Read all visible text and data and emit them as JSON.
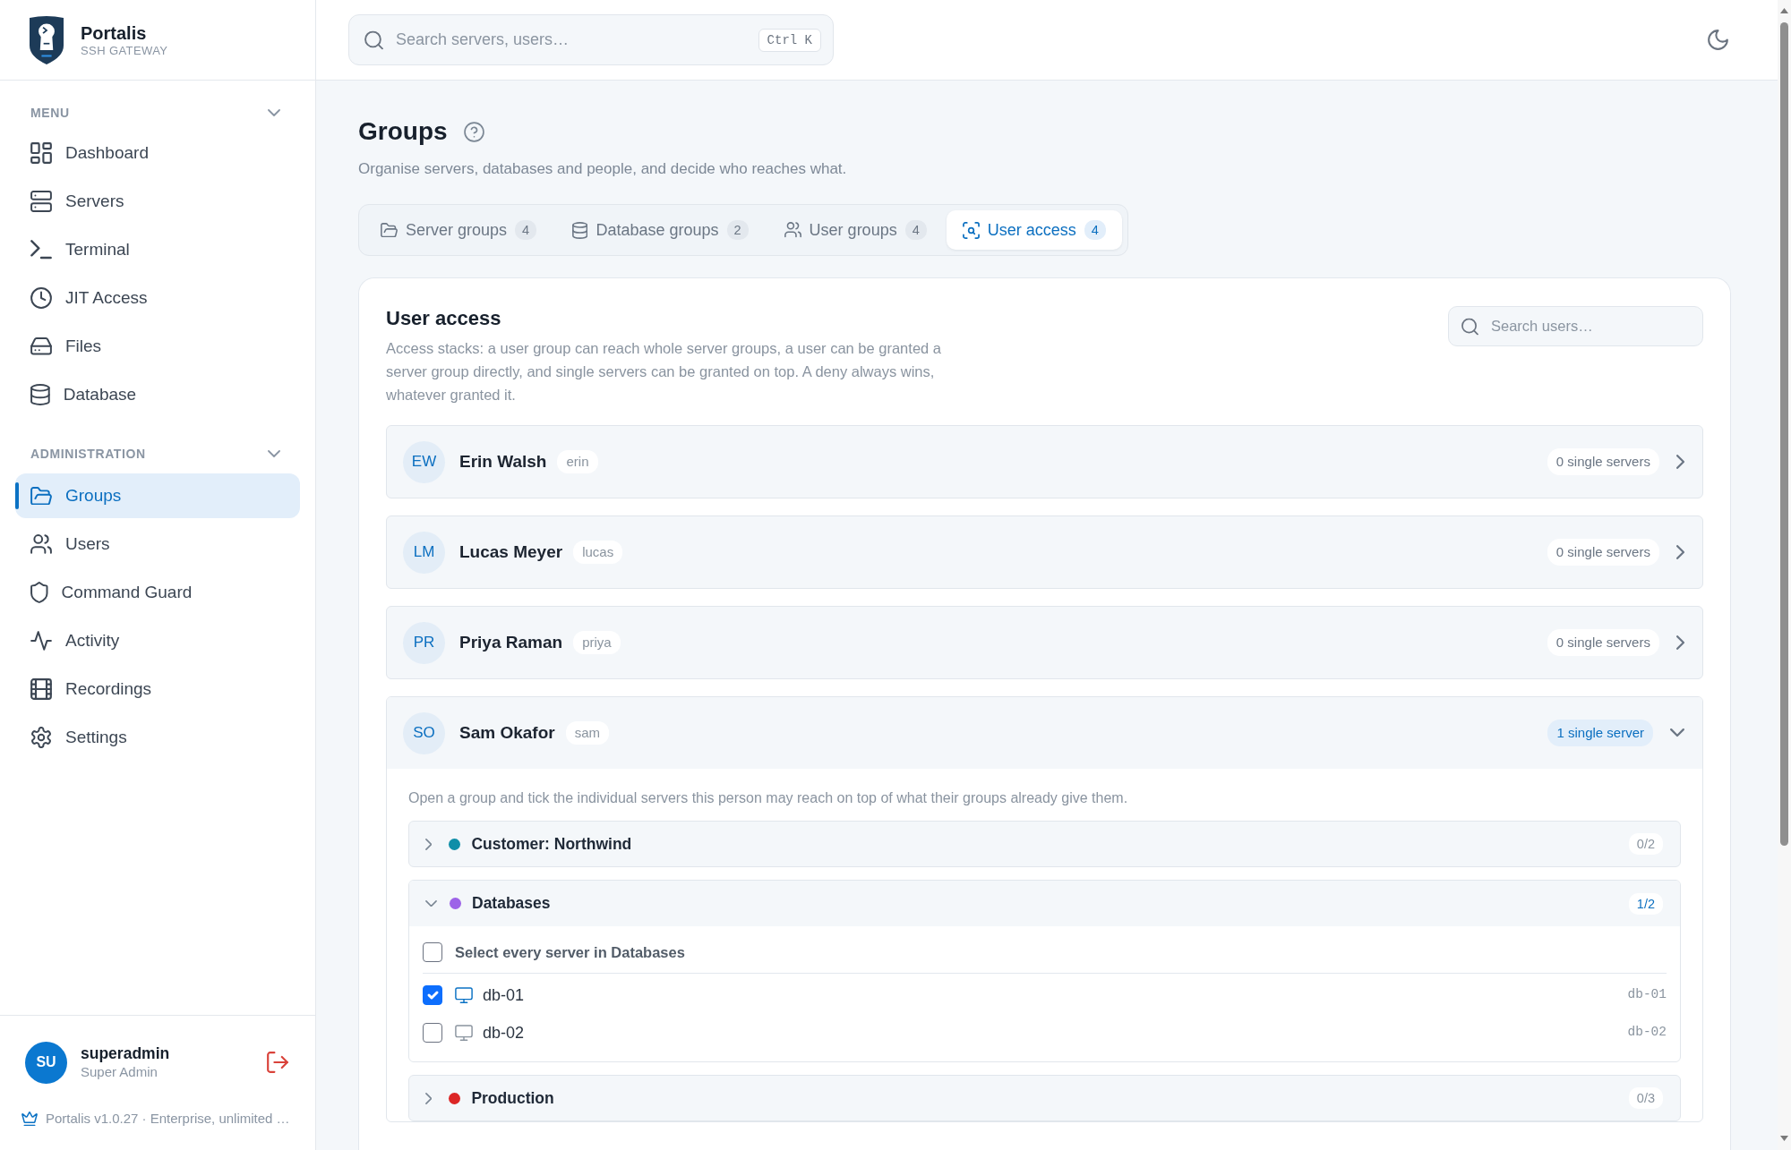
{
  "app": {
    "name": "Portalis",
    "tagline": "SSH GATEWAY"
  },
  "sidebar": {
    "sections": [
      {
        "label": "MENU",
        "expanded": true,
        "items": [
          {
            "label": "Dashboard",
            "selected": false
          },
          {
            "label": "Servers",
            "selected": false
          },
          {
            "label": "Terminal",
            "selected": false
          },
          {
            "label": "JIT Access",
            "selected": false
          },
          {
            "label": "Files",
            "selected": false
          },
          {
            "label": "Database",
            "selected": false
          }
        ]
      },
      {
        "label": "ADMINISTRATION",
        "expanded": true,
        "items": [
          {
            "label": "Groups",
            "selected": true
          },
          {
            "label": "Users",
            "selected": false
          },
          {
            "label": "Command Guard",
            "selected": false
          },
          {
            "label": "Activity",
            "selected": false
          },
          {
            "label": "Recordings",
            "selected": false
          },
          {
            "label": "Settings",
            "selected": false
          }
        ]
      }
    ],
    "user": {
      "initials": "SU",
      "name": "superadmin",
      "role": "Super Admin"
    },
    "footer": "Portalis v1.0.27 · Enterprise, unlimited …"
  },
  "topbar": {
    "search": {
      "placeholder": "Search servers, users…",
      "shortcut": "Ctrl K"
    }
  },
  "page": {
    "title": "Groups",
    "subtitle": "Organise servers, databases and people, and decide who reaches what."
  },
  "tabs": [
    {
      "label": "Server groups",
      "count": "4",
      "selected": false
    },
    {
      "label": "Database groups",
      "count": "2",
      "selected": false
    },
    {
      "label": "User groups",
      "count": "4",
      "selected": false
    },
    {
      "label": "User access",
      "count": "4",
      "selected": true
    }
  ],
  "panel": {
    "title": "User access",
    "description": "Access stacks: a user group can reach whole server groups, a user can be granted a server group directly, and single servers can be granted on top. A deny always wins, whatever granted it.",
    "search": {
      "placeholder": "Search users…"
    },
    "users": [
      {
        "initials": "EW",
        "name": "Erin Walsh",
        "username": "erin",
        "summary": "0 single servers",
        "highlighted": false,
        "expanded": false
      },
      {
        "initials": "LM",
        "name": "Lucas Meyer",
        "username": "lucas",
        "summary": "0 single servers",
        "highlighted": false,
        "expanded": false
      },
      {
        "initials": "PR",
        "name": "Priya Raman",
        "username": "priya",
        "summary": "0 single servers",
        "highlighted": false,
        "expanded": false
      },
      {
        "initials": "SO",
        "name": "Sam Okafor",
        "username": "sam",
        "summary": "1 single server",
        "highlighted": true,
        "expanded": true,
        "hint": "Open a group and tick the individual servers this person may reach on top of what their groups already give them.",
        "groups": [
          {
            "name": "Customer: Northwind",
            "color": "#0f8ea8",
            "count": "0/2",
            "highlighted": false,
            "expanded": false
          },
          {
            "name": "Databases",
            "color": "#9d63e8",
            "count": "1/2",
            "highlighted": true,
            "expanded": true,
            "select_all": {
              "label": "Select every server in Databases",
              "checked": false
            },
            "servers": [
              {
                "name": "db-01",
                "host": "db-01",
                "checked": true
              },
              {
                "name": "db-02",
                "host": "db-02",
                "checked": false
              }
            ]
          },
          {
            "name": "Production",
            "color": "#dc2626",
            "count": "0/3",
            "highlighted": false,
            "expanded": false
          }
        ]
      }
    ]
  }
}
